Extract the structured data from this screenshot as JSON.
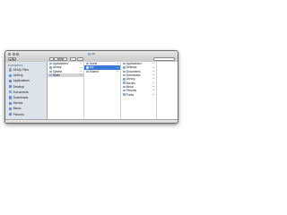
{
  "window": {
    "title": "oo",
    "nav_back": "◀",
    "nav_forward": "▶"
  },
  "sidebar": {
    "header": "FAVORITES",
    "items": [
      {
        "label": "All My Files",
        "icon": "all-files-icon",
        "color": "#8e9fb6"
      },
      {
        "label": "AirDrop",
        "icon": "airdrop-icon",
        "color": "#4fa0e0"
      },
      {
        "label": "Applications",
        "icon": "applications-icon",
        "color": "#6f86c8"
      },
      {
        "label": "Desktop",
        "icon": "desktop-icon",
        "color": "#5b8fd6"
      },
      {
        "label": "Documents",
        "icon": "documents-icon",
        "color": "#7fa7dc"
      },
      {
        "label": "Downloads",
        "icon": "downloads-icon",
        "color": "#5f98e0"
      },
      {
        "label": "Movies",
        "icon": "movies-icon",
        "color": "#6d8fcf"
      },
      {
        "label": "Music",
        "icon": "music-icon",
        "color": "#6d8fcf"
      },
      {
        "label": "Pictures",
        "icon": "pictures-icon",
        "color": "#6d8fcf"
      }
    ]
  },
  "columns": [
    {
      "rows": [
        {
          "label": "Applications",
          "folder": true
        },
        {
          "label": "Library",
          "folder": true
        },
        {
          "label": "System",
          "folder": true
        },
        {
          "label": "Users",
          "folder": true,
          "state": "selected-inactive"
        }
      ]
    },
    {
      "rows": [
        {
          "label": "Guest",
          "folder": true
        },
        {
          "label": "xyz",
          "folder": true,
          "state": "selected"
        },
        {
          "label": "Shared",
          "folder": true
        }
      ]
    },
    {
      "rows": [
        {
          "label": "Applications",
          "folder": true
        },
        {
          "label": "Desktop",
          "folder": true
        },
        {
          "label": "Documents",
          "folder": true
        },
        {
          "label": "Downloads",
          "folder": true
        },
        {
          "label": "Library",
          "folder": true
        },
        {
          "label": "Movies",
          "folder": true
        },
        {
          "label": "Music",
          "folder": true
        },
        {
          "label": "Pictures",
          "folder": true
        },
        {
          "label": "Public",
          "folder": true
        }
      ]
    }
  ],
  "colors": {
    "selection": "#3a78d5",
    "sidebar_bg": "#dde3ea"
  }
}
